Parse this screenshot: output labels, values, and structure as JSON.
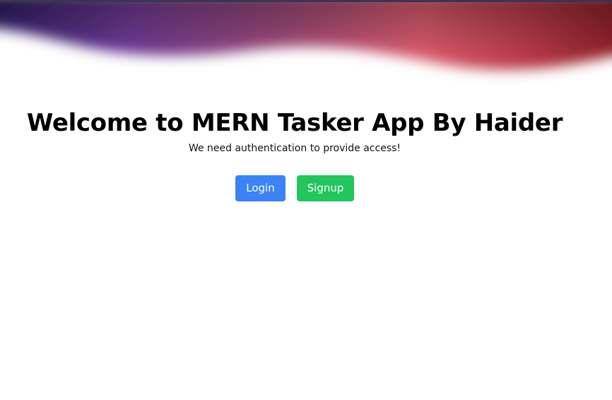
{
  "header": {
    "decoration": "gradient-wave",
    "gradient_colors": [
      "#2e1f66",
      "#7b3a9a",
      "#e0606e",
      "#8a1e25"
    ]
  },
  "welcome": {
    "title": "Welcome to MERN Tasker App By Haider",
    "subtitle": "We need authentication to provide access!"
  },
  "buttons": {
    "login_label": "Login",
    "signup_label": "Signup",
    "login_color": "#3b82f6",
    "signup_color": "#22c55e"
  }
}
